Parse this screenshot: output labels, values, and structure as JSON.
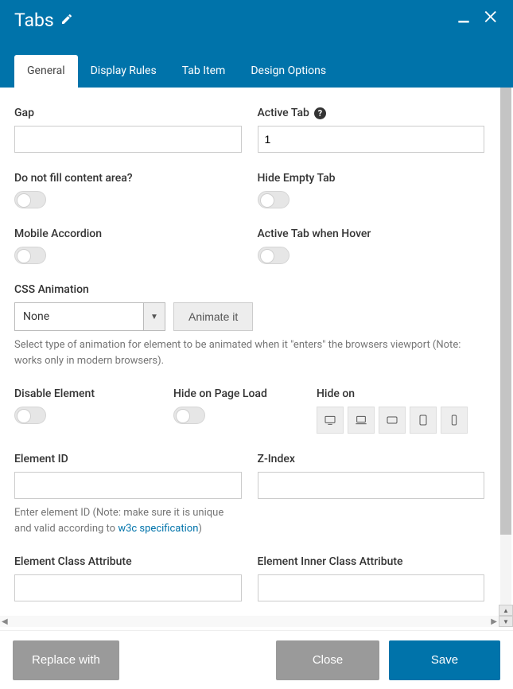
{
  "header": {
    "title": "Tabs"
  },
  "tabs": {
    "general": "General",
    "display_rules": "Display Rules",
    "tab_item": "Tab Item",
    "design_options": "Design Options"
  },
  "fields": {
    "gap": {
      "label": "Gap",
      "value": ""
    },
    "active_tab": {
      "label": "Active Tab",
      "value": "1"
    },
    "do_not_fill": {
      "label": "Do not fill content area?"
    },
    "hide_empty": {
      "label": "Hide Empty Tab"
    },
    "mobile_accordion": {
      "label": "Mobile Accordion"
    },
    "active_hover": {
      "label": "Active Tab when Hover"
    },
    "css_animation": {
      "label": "CSS Animation",
      "value": "None",
      "button": "Animate it",
      "note_a": "Select type of animation for element to be animated when it \"enters\" the browsers viewport (Note: works only in modern browsers).",
      "note_b": ""
    },
    "disable_element": {
      "label": "Disable Element"
    },
    "hide_page_load": {
      "label": "Hide on Page Load"
    },
    "hide_on": {
      "label": "Hide on"
    },
    "element_id": {
      "label": "Element ID",
      "value": "",
      "note_prefix": "Enter element ID (Note: make sure it is unique and valid according to ",
      "link_text": "w3c specification",
      "note_suffix": ")"
    },
    "z_index": {
      "label": "Z-Index",
      "value": ""
    },
    "el_class": {
      "label": "Element Class Attribute",
      "value": ""
    },
    "el_inner_class": {
      "label": "Element Inner Class Attribute",
      "value": ""
    }
  },
  "footer": {
    "replace": "Replace with",
    "close": "Close",
    "save": "Save"
  }
}
